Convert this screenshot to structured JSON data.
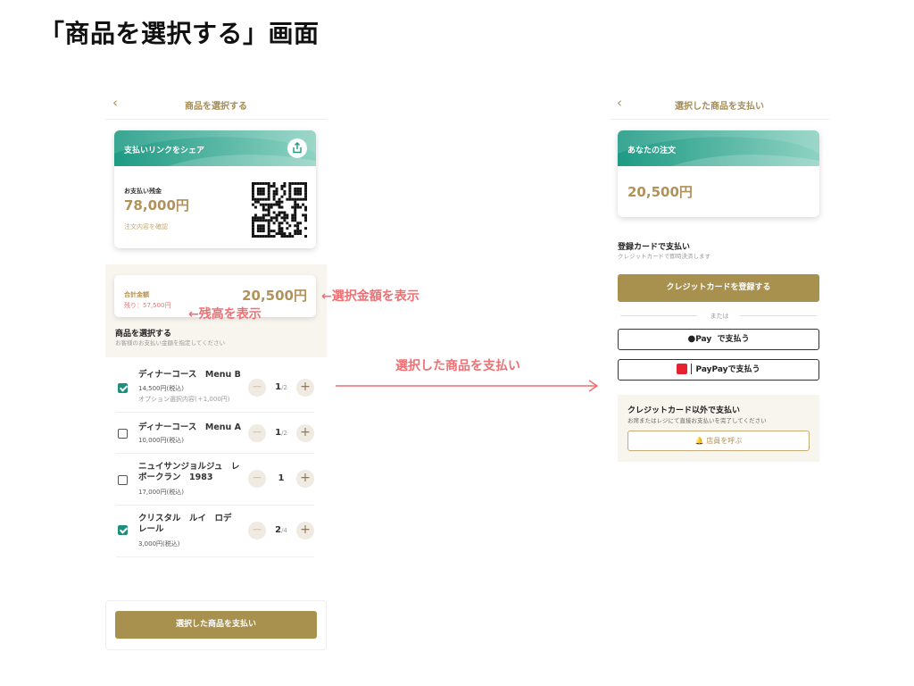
{
  "slide": {
    "title": "「商品を選択する」画面"
  },
  "screen_select": {
    "nav": {
      "back": "‹",
      "title": "商品を選択する"
    },
    "share_card": {
      "header": "支払いリンクをシェア",
      "balance_label": "お支払い残金",
      "balance_amount": "78,000円",
      "link_text": "注文内容を確認",
      "share_icon": "share-icon",
      "qr_icon": "qr-code"
    },
    "total_card": {
      "label": "合計金額",
      "remaining": "残り：57,500円",
      "amount": "20,500円"
    },
    "section": {
      "title": "商品を選択する",
      "subtitle": "お客様のお支払い金額を指定してください"
    },
    "items": [
      {
        "name": "ディナーコース　Menu B",
        "price": "14,500円(税込)",
        "option": "オプション選択内容(＋1,000円)",
        "qty": "1",
        "qty_total": "/2",
        "checked": true
      },
      {
        "name": "ディナーコース　Menu A",
        "price": "10,000円(税込)",
        "option": "",
        "qty": "1",
        "qty_total": "/2",
        "checked": false
      },
      {
        "name": "ニュイサンジョルジュ　レ\nボークラン　1983",
        "price": "17,000円(税込)",
        "option": "",
        "qty": "1",
        "qty_total": "",
        "checked": false
      },
      {
        "name": "クリスタル　ルイ　ロデ\nレール",
        "price": "3,000円(税込)",
        "option": "",
        "qty": "2",
        "qty_total": "/4",
        "checked": true
      }
    ],
    "stepper": {
      "minus": "−",
      "plus": "+"
    },
    "pay_button": "選択した商品を支払い"
  },
  "annotations": {
    "amount": "←選択金額を表示",
    "balance": "←残高を表示",
    "flow": "選択した商品を支払い"
  },
  "screen_pay": {
    "nav": {
      "back": "‹",
      "title": "選択した商品を支払い"
    },
    "order_card": {
      "header": "あなたの注文",
      "amount": "20,500円"
    },
    "card_section": {
      "title": "登録カードで支払い",
      "subtitle": "クレジットカードで即時決済します",
      "register_button": "クレジットカードを登録する"
    },
    "or_text": "または",
    "apple_pay": {
      "brand": "Pay",
      "suffix": "で支払う"
    },
    "paypay": {
      "label": "PayPayで支払う"
    },
    "other_section": {
      "title": "クレジットカード以外で支払い",
      "subtitle": "お席またはレジにて直接お支払いを完了してください",
      "staff_button": "店員を呼ぶ"
    }
  },
  "colors": {
    "teal": "#1e9a84",
    "gold": "#a8904e",
    "annotation": "#ef6f72",
    "beige_bg": "#f8f5ef"
  }
}
